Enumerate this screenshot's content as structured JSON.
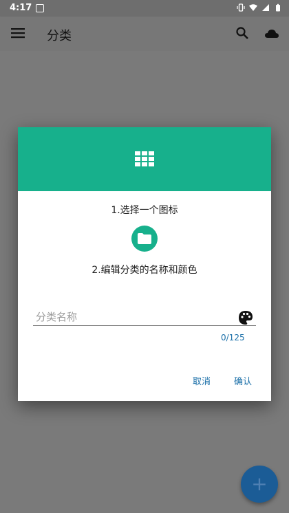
{
  "status_bar": {
    "time": "4:17"
  },
  "app_bar": {
    "title": "分类"
  },
  "dialog": {
    "step1": "1.选择一个图标",
    "step2": "2.编辑分类的名称和颜色",
    "name_placeholder": "分类名称",
    "name_value": "",
    "counter": "0/125",
    "cancel_label": "取消",
    "confirm_label": "确认",
    "header_color": "#17b08c"
  },
  "fab": {
    "label": "+"
  },
  "icons": [
    "menu-icon",
    "search-icon",
    "cloud-icon",
    "grid-icon",
    "folder-icon",
    "palette-icon",
    "add-icon"
  ]
}
